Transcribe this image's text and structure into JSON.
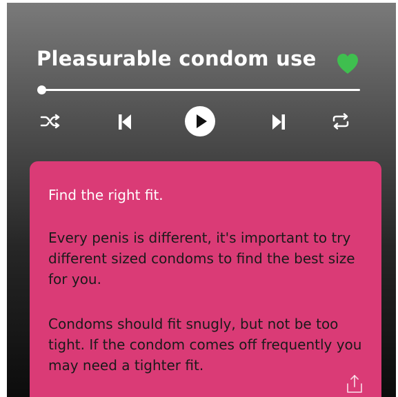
{
  "player": {
    "title": "Pleasurable condom use",
    "favorited": true,
    "progress": 0,
    "accent_color": "#3fbf4f",
    "controls": [
      "shuffle-icon",
      "previous-icon",
      "play-icon",
      "next-icon",
      "repeat-icon"
    ]
  },
  "card": {
    "color": "#da3b76",
    "heading": "Find the right fit.",
    "paragraph1": "Every penis is different, it's important to try different sized condoms to find the best size for you.",
    "paragraph2": "Condoms should fit snugly, but not be too tight. If the condom comes off frequently you may need a tighter fit.",
    "share_icon": "share-icon"
  }
}
